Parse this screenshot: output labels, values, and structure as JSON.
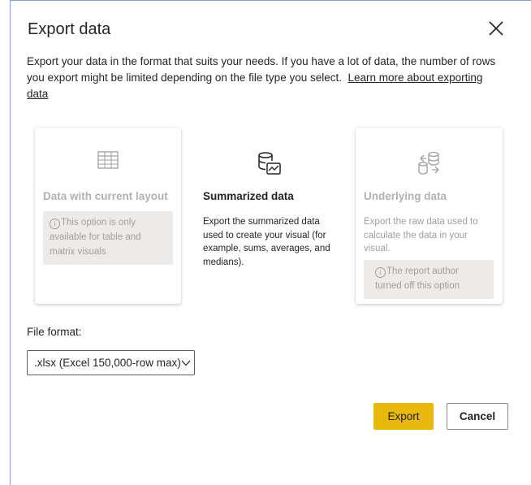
{
  "dialog": {
    "title": "Export data",
    "description": "Export your data in the format that suits your needs. If you have a lot of data, the number of rows you export might be limited depending on the file type you select.",
    "learn_more_link": "Learn more about exporting data"
  },
  "options": [
    {
      "title": "Data with current layout",
      "icon": "table-icon",
      "enabled": false,
      "info_icon": "i",
      "info": "This option is only available for table and matrix visuals"
    },
    {
      "title": "Summarized data",
      "icon": "database-chart-icon",
      "enabled": true,
      "selected": true,
      "description": "Export the summarized data used to create your visual (for example, sums, averages, and medians)."
    },
    {
      "title": "Underlying data",
      "icon": "database-sync-icon",
      "enabled": false,
      "description": "Export the raw data used to calculate the data in your visual.",
      "info_icon": "i",
      "info": "The report author turned off this option"
    }
  ],
  "file_format": {
    "label": "File format:",
    "selected": ".xlsx (Excel 150,000-row max)"
  },
  "buttons": {
    "export": "Export",
    "cancel": "Cancel"
  },
  "colors": {
    "primary_button": "#e9b80c",
    "disabled_text": "#b3b0ad",
    "info_background": "#edebe9",
    "text": "#252423"
  }
}
